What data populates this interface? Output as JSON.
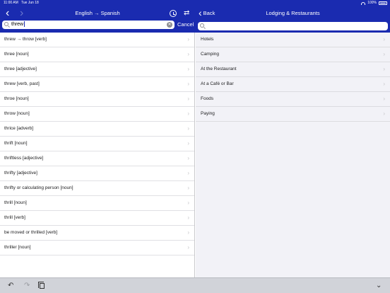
{
  "status": {
    "time": "11:00 AM",
    "date": "Tue Jun 18",
    "battery": "100%"
  },
  "left_nav": {
    "title": "English → Spanish",
    "back_icon": "chevron-left-icon",
    "forward_icon": "chevron-right-icon",
    "history_icon": "clock-icon",
    "swap_icon": "swap-arrows-icon"
  },
  "search": {
    "value": "threw",
    "cancel": "Cancel",
    "placeholder": ""
  },
  "results": [
    "threw → throw [verb]",
    "three [noun]",
    "three [adjective]",
    "threw [verb, past]",
    "throe [noun]",
    "throw [noun]",
    "thrice [adverb]",
    "thrift [noun]",
    "thriftless [adjective]",
    "thrifty [adjective]",
    "thrifty or calculating person [noun]",
    "thrill [noun]",
    "thrill [verb]",
    "be moved or thrilled [verb]",
    "thriller [noun]"
  ],
  "right_nav": {
    "back": "Back",
    "title": "Lodging & Restaurants"
  },
  "categories": [
    "Hotels",
    "Camping",
    "At the Restaurant",
    "At a Café or Bar",
    "Foods",
    "Paying"
  ],
  "toolbar": {
    "undo_icon": "undo-icon",
    "redo_icon": "redo-icon",
    "copy_icon": "copy-icon",
    "dismiss_icon": "chevron-down-icon"
  },
  "colors": {
    "accent": "#1a2bb0",
    "toolbar": "#d1d3d9",
    "detail_background": "#f2f2f7"
  }
}
